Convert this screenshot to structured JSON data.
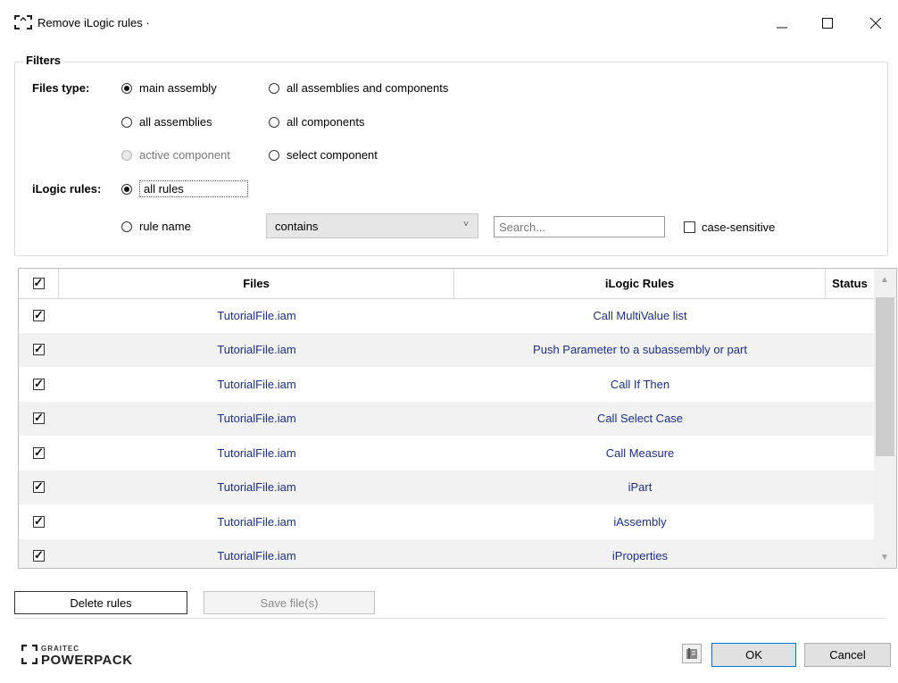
{
  "window": {
    "title": "Remove iLogic rules ·",
    "minimize_icon": "minimize-icon",
    "maximize_icon": "maximize-icon",
    "close_icon": "close-icon"
  },
  "filters": {
    "group_title": "Filters",
    "files_type_label": "Files type:",
    "files_type_options": [
      {
        "label": "main assembly",
        "selected": true,
        "enabled": true
      },
      {
        "label": "all assemblies and components",
        "selected": false,
        "enabled": true
      },
      {
        "label": "all assemblies",
        "selected": false,
        "enabled": true
      },
      {
        "label": "all components",
        "selected": false,
        "enabled": true
      },
      {
        "label": "active component",
        "selected": false,
        "enabled": false
      },
      {
        "label": "select component",
        "selected": false,
        "enabled": true
      }
    ],
    "ilogic_rules_label": "iLogic rules:",
    "rule_options": [
      {
        "label": "all rules",
        "selected": true
      },
      {
        "label": "rule name",
        "selected": false
      }
    ],
    "match_mode": "contains",
    "search_placeholder": "Search...",
    "search_value": "",
    "case_sensitive_label": "case-sensitive",
    "case_sensitive": false
  },
  "grid": {
    "columns": {
      "files": "Files",
      "rules": "iLogic Rules",
      "status": "Status"
    },
    "all_checked": true,
    "rows": [
      {
        "checked": true,
        "file": "TutorialFile.iam",
        "rule": "Call MultiValue list",
        "status": ""
      },
      {
        "checked": true,
        "file": "TutorialFile.iam",
        "rule": "Push Parameter to a subassembly or part",
        "status": ""
      },
      {
        "checked": true,
        "file": "TutorialFile.iam",
        "rule": "Call If Then",
        "status": ""
      },
      {
        "checked": true,
        "file": "TutorialFile.iam",
        "rule": "Call Select Case",
        "status": ""
      },
      {
        "checked": true,
        "file": "TutorialFile.iam",
        "rule": "Call Measure",
        "status": ""
      },
      {
        "checked": true,
        "file": "TutorialFile.iam",
        "rule": "iPart",
        "status": ""
      },
      {
        "checked": true,
        "file": "TutorialFile.iam",
        "rule": "iAssembly",
        "status": ""
      },
      {
        "checked": true,
        "file": "TutorialFile.iam",
        "rule": "iProperties",
        "status": ""
      }
    ]
  },
  "actions": {
    "delete_label": "Delete rules",
    "save_label": "Save file(s)"
  },
  "footer": {
    "brand_top": "GRAITEC",
    "brand_main": "POWERPACK",
    "ok_label": "OK",
    "cancel_label": "Cancel"
  },
  "colors": {
    "link_text": "#1b2e8a",
    "ok_border": "#0078d7",
    "row_alt": "#f2f2f2"
  }
}
